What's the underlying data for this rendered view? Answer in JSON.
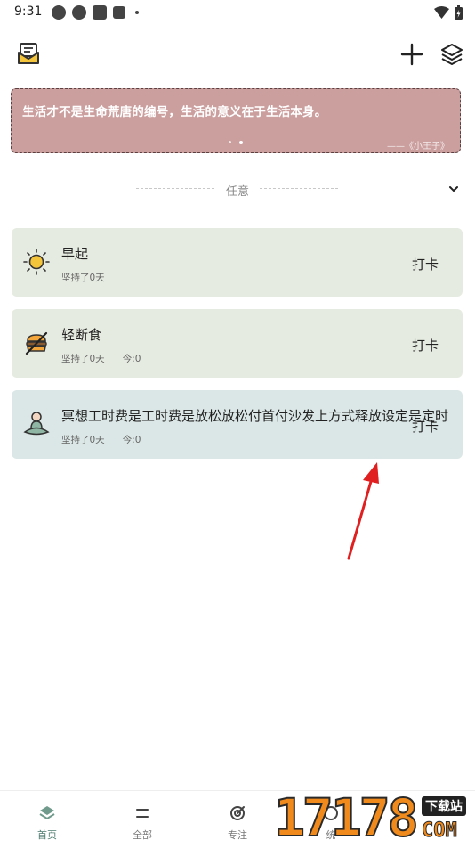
{
  "status_bar": {
    "time": "9:31"
  },
  "quote": {
    "text": "生活才不是生命荒唐的编号，生活的意义在于生活本身。",
    "source": "——《小王子》"
  },
  "filter": {
    "label": "任意"
  },
  "habits": [
    {
      "title": "早起",
      "streak": "坚持了0天",
      "today": "",
      "action": "打卡",
      "icon": "sun-icon"
    },
    {
      "title": "轻断食",
      "streak": "坚持了0天",
      "today": "今:0",
      "action": "打卡",
      "icon": "burger-off-icon"
    },
    {
      "title": "冥想工时费是工时费是放松放松付首付沙发上方式释放设定是定时",
      "streak": "坚持了0天",
      "today": "今:0",
      "action": "打卡",
      "icon": "meditation-icon"
    }
  ],
  "nav": [
    {
      "label": "首页",
      "icon": "home-layers-icon"
    },
    {
      "label": "全部",
      "icon": "menu-icon"
    },
    {
      "label": "专注",
      "icon": "target-icon"
    },
    {
      "label": "统",
      "icon": "stats-icon"
    }
  ],
  "watermark": {
    "digits": "17178",
    "box_text": "下载站",
    "com_text": "COM"
  },
  "colors": {
    "quote_bg": "#cc9f9f",
    "card_green": "#e6ebe1",
    "card_blue": "#dbe7e6",
    "nav_active": "#4f7d6f",
    "arrow": "#e02020"
  }
}
